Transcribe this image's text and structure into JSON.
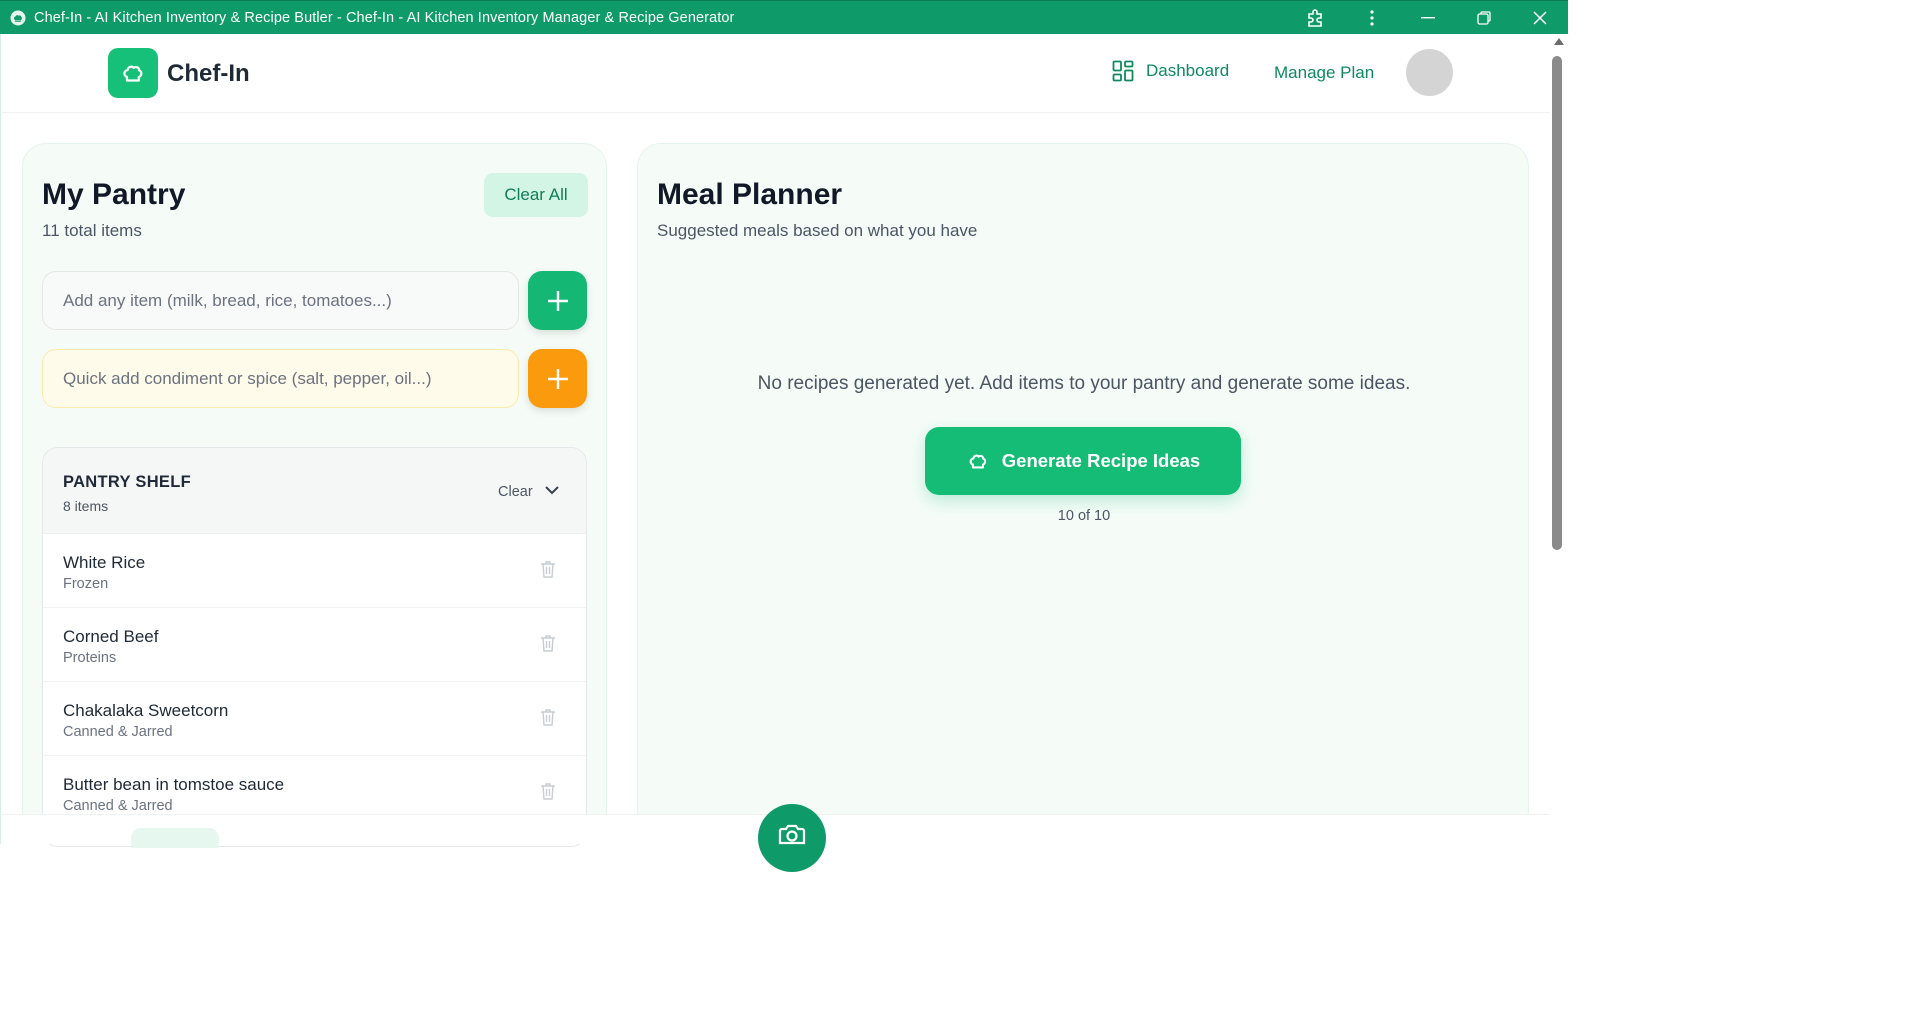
{
  "window": {
    "title": "Chef-In - AI Kitchen Inventory & Recipe Butler - Chef-In - AI Kitchen Inventory Manager & Recipe Generator"
  },
  "header": {
    "brand": "Chef-In",
    "nav": {
      "dashboard": "Dashboard",
      "manage_plan": "Manage Plan"
    }
  },
  "pantry": {
    "title": "My Pantry",
    "total": "11 total items",
    "clear_all": "Clear All",
    "add_placeholder": "Add any item (milk, bread, rice, tomatoes...)",
    "spice_placeholder": "Quick add condiment or spice (salt, pepper, oil...)",
    "shelf": {
      "title": "PANTRY SHELF",
      "count": "8 items",
      "clear": "Clear",
      "items": [
        {
          "name": "White Rice",
          "category": "Frozen"
        },
        {
          "name": "Corned Beef",
          "category": "Proteins"
        },
        {
          "name": "Chakalaka Sweetcorn",
          "category": "Canned & Jarred"
        },
        {
          "name": "Butter bean in tomstoe sauce",
          "category": "Canned & Jarred"
        }
      ]
    }
  },
  "planner": {
    "title": "Meal Planner",
    "subtitle": "Suggested meals based on what you have",
    "empty": "No recipes generated yet. Add items to your pantry and generate some ideas.",
    "generate": "Generate Recipe Ideas",
    "quota": "10 of 10"
  },
  "colors": {
    "brand_green": "#14bc76",
    "titlebar": "#0f9a6a",
    "accent_orange": "#fb9a0c"
  }
}
